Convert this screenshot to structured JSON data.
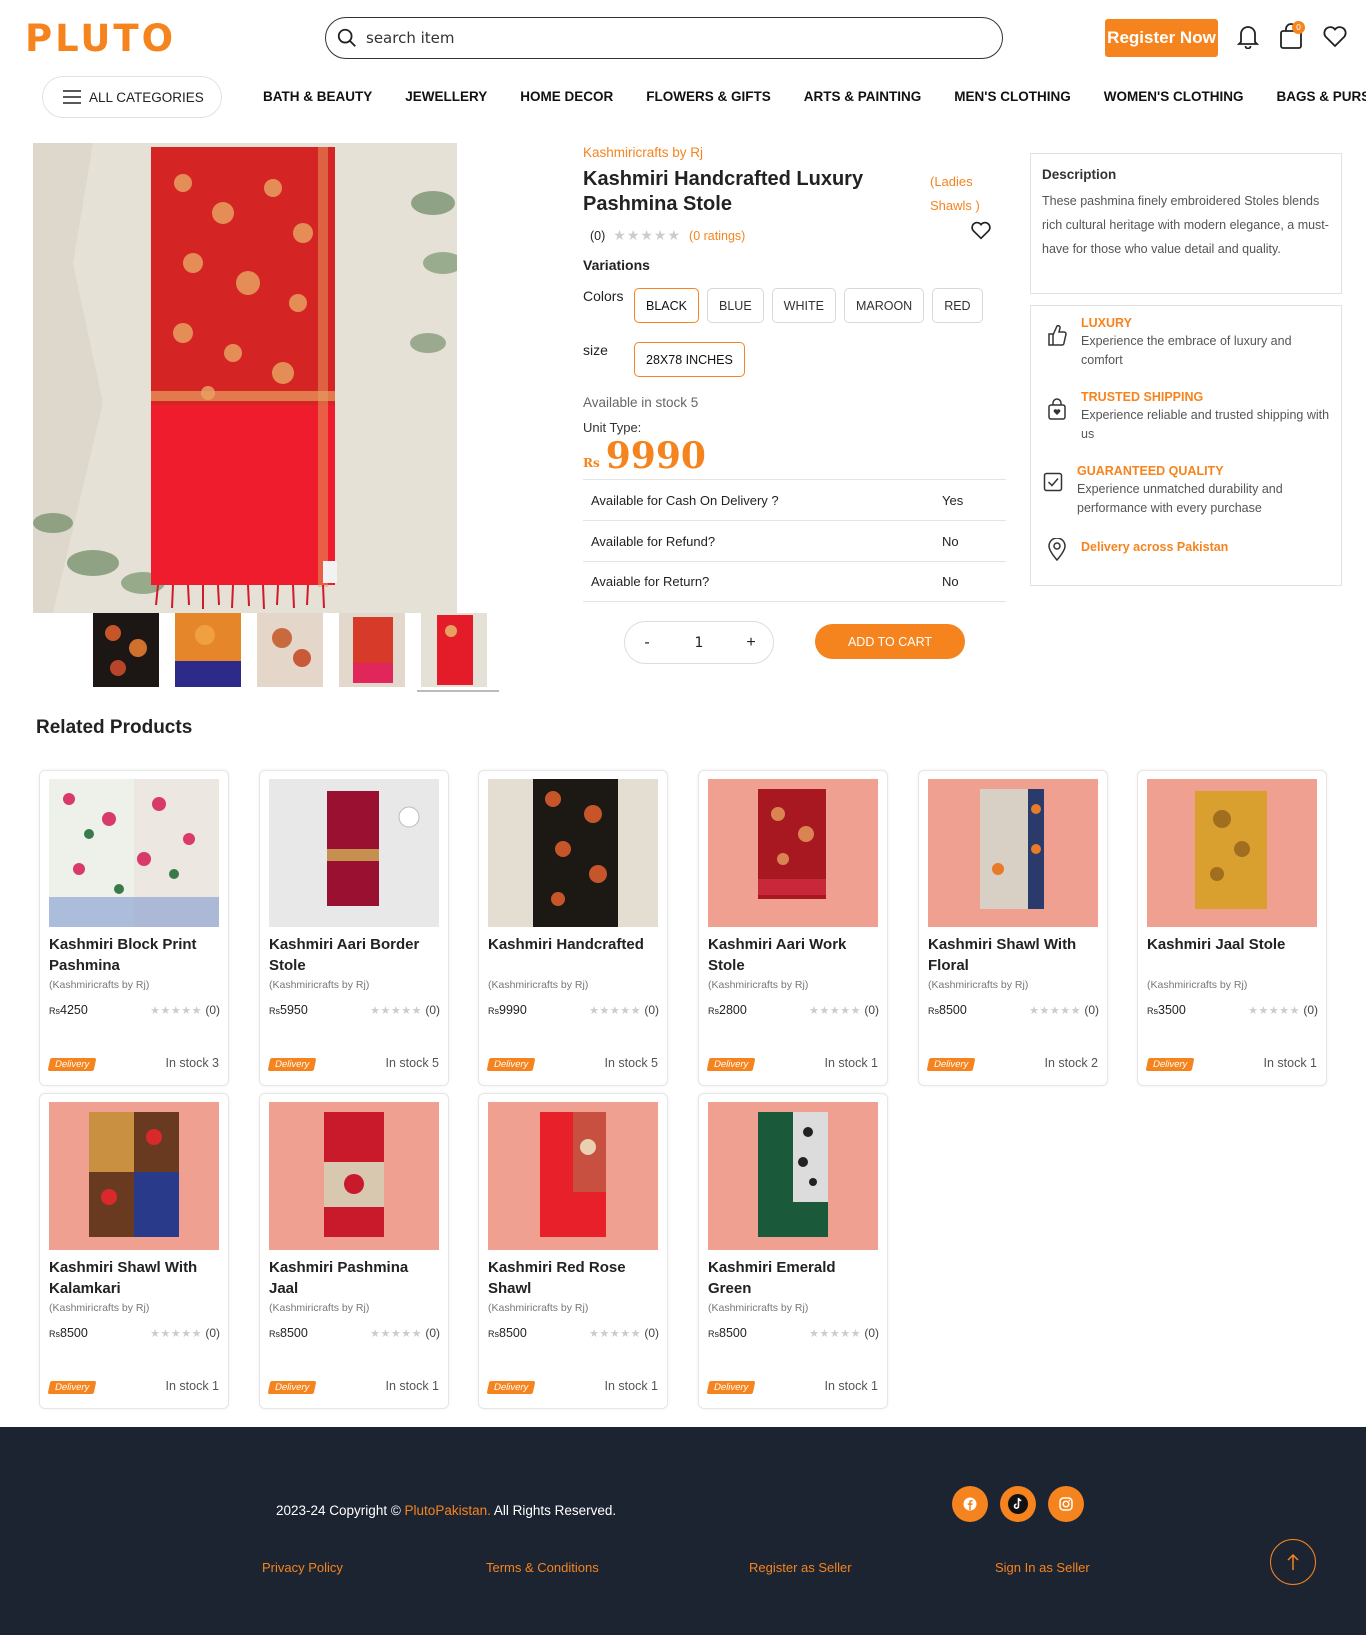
{
  "brand": {
    "logo": "PLUTO",
    "accent": "#f5841f"
  },
  "header": {
    "search_placeholder": "search item",
    "register_label": "Register Now",
    "cart_count": "0"
  },
  "nav": {
    "all_categories": "ALL CATEGORIES",
    "items": [
      "BATH & BEAUTY",
      "JEWELLERY",
      "HOME DECOR",
      "FLOWERS & GIFTS",
      "ARTS & PAINTING",
      "MEN'S CLOTHING",
      "WOMEN'S CLOTHING",
      "BAGS & PURSES"
    ]
  },
  "product": {
    "store": "Kashmiricrafts by Rj",
    "title": "Kashmiri Handcrafted Luxury Pashmina Stole",
    "category": "(Ladies Shawls )",
    "rating_count": "(0)",
    "ratings_text": "(0 ratings)",
    "variations_label": "Variations",
    "colors_label": "Colors",
    "colors": [
      "BLACK",
      "BLUE",
      "WHITE",
      "MAROON",
      "RED"
    ],
    "selected_color": "BLACK",
    "size_label": "size",
    "sizes": [
      "28X78 INCHES"
    ],
    "stock_text": "Available in stock 5",
    "unit_type_label": "Unit Type:",
    "currency": "Rs",
    "price": "9990",
    "info": [
      {
        "label": "Available for Cash On Delivery ?",
        "value": "Yes"
      },
      {
        "label": "Available for Refund?",
        "value": "No"
      },
      {
        "label": "Avaiable for Return?",
        "value": "No"
      }
    ],
    "quantity": "1",
    "qty_minus": "-",
    "qty_plus": "+",
    "add_to_cart": "ADD TO CART"
  },
  "description": {
    "heading": "Description",
    "text": "These pashmina finely embroidered Stoles blends rich cultural heritage with modern elegance, a must-have for those who value detail and quality."
  },
  "features": [
    {
      "title": "LUXURY",
      "text": "Experience the embrace of luxury and comfort",
      "icon": "thumbs-up-icon"
    },
    {
      "title": "TRUSTED SHIPPING",
      "text": "Experience reliable and trusted shipping with us",
      "icon": "shopping-bag-icon"
    },
    {
      "title": "GUARANTEED QUALITY",
      "text": "Experience unmatched durability and performance with every purchase",
      "icon": "checkbox-icon"
    },
    {
      "title": "Delivery across Pakistan",
      "text": "",
      "icon": "location-pin-icon"
    }
  ],
  "related": {
    "heading": "Related Products",
    "currency": "Rs",
    "rating": "(0)",
    "delivery": "Delivery",
    "products": [
      {
        "name": "Kashmiri Block Print Pashmina",
        "store": "(Kashmiricrafts by Rj)",
        "price": "4250",
        "stock": "In stock 3"
      },
      {
        "name": "Kashmiri Aari Border Stole",
        "store": "(Kashmiricrafts by Rj)",
        "price": "5950",
        "stock": "In stock 5"
      },
      {
        "name": "Kashmiri Handcrafted",
        "store": "(Kashmiricrafts by Rj)",
        "price": "9990",
        "stock": "In stock 5"
      },
      {
        "name": "Kashmiri Aari Work Stole",
        "store": "(Kashmiricrafts by Rj)",
        "price": "2800",
        "stock": "In stock 1"
      },
      {
        "name": "Kashmiri Shawl With Floral",
        "store": "(Kashmiricrafts by Rj)",
        "price": "8500",
        "stock": "In stock 2"
      },
      {
        "name": "Kashmiri Jaal Stole",
        "store": "(Kashmiricrafts by Rj)",
        "price": "3500",
        "stock": "In stock 1"
      },
      {
        "name": "Kashmiri Shawl With Kalamkari",
        "store": "(Kashmiricrafts by Rj)",
        "price": "8500",
        "stock": "In stock 1"
      },
      {
        "name": "Kashmiri Pashmina Jaal",
        "store": "(Kashmiricrafts by Rj)",
        "price": "8500",
        "stock": "In stock 1"
      },
      {
        "name": "Kashmiri Red Rose Shawl",
        "store": "(Kashmiricrafts by Rj)",
        "price": "8500",
        "stock": "In stock 1"
      },
      {
        "name": "Kashmiri Emerald Green",
        "store": "(Kashmiricrafts by Rj)",
        "price": "8500",
        "stock": "In stock 1"
      }
    ]
  },
  "footer": {
    "copyright_pre": "2023-24 Copyright ©",
    "brand": "PlutoPakistan.",
    "copyright_post": "All Rights Reserved.",
    "links": [
      "Privacy Policy",
      "Terms & Conditions",
      "Register as Seller",
      "Sign In as Seller"
    ],
    "social": [
      "facebook-icon",
      "tiktok-icon",
      "instagram-icon"
    ]
  }
}
